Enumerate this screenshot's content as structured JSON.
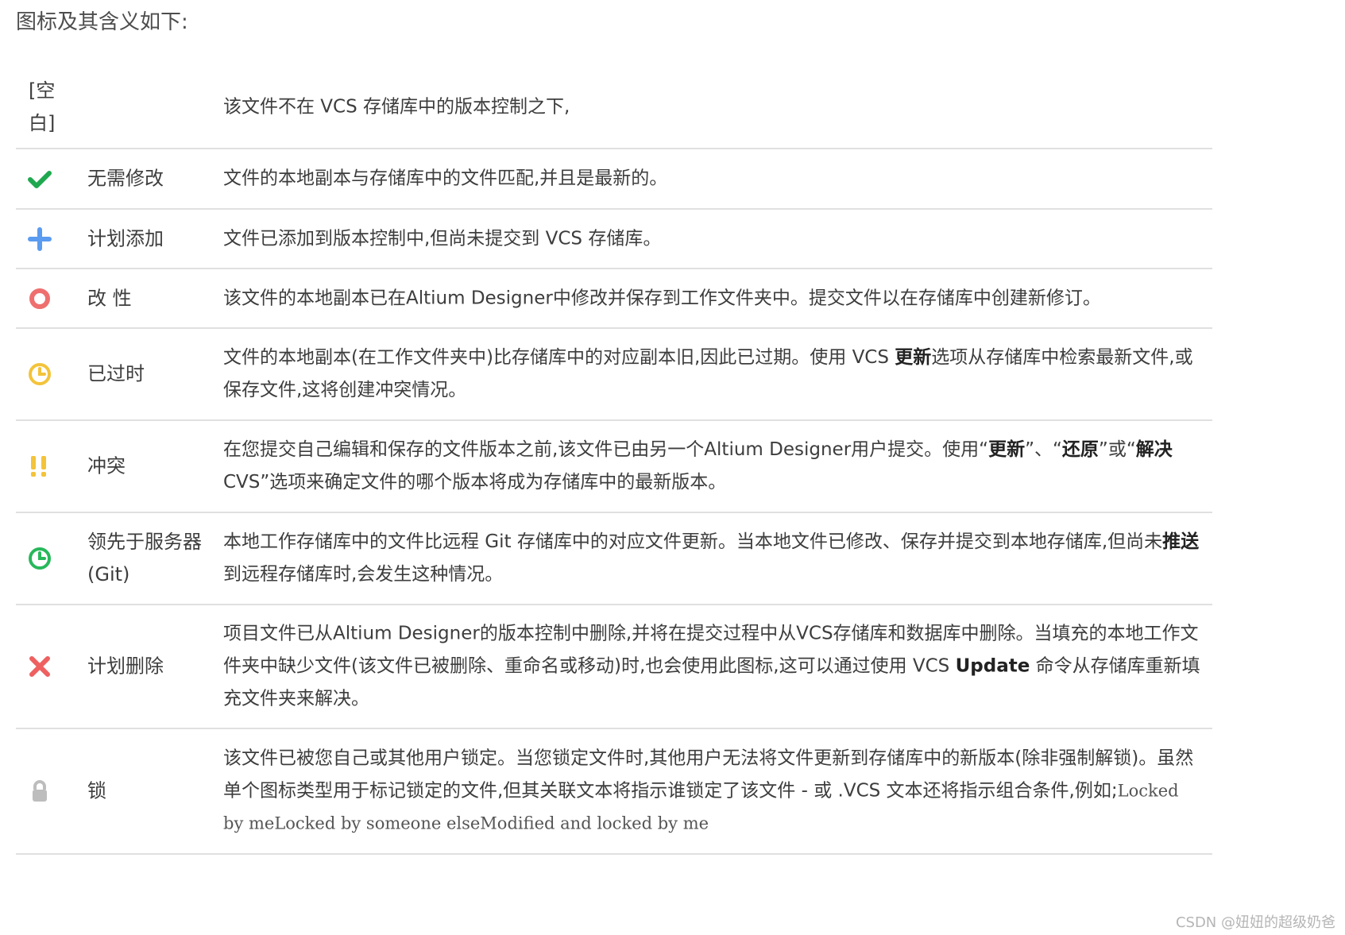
{
  "intro": "图标及其含义如下:",
  "colors": {
    "check": "#1fa84f",
    "plus": "#5b9bf0",
    "circle": "#ef6f6f",
    "clock_yellow": "#f3c33a",
    "exclaim": "#f3c33a",
    "clock_green": "#27b85a",
    "cross": "#ef6060",
    "lock": "#bdbdbd"
  },
  "rows": [
    {
      "icon": "none",
      "name": "[空白]",
      "desc": "该文件不在 VCS 存储库中的版本控制之下,"
    },
    {
      "icon": "check-icon",
      "name": "无需修改",
      "desc": "文件的本地副本与存储库中的文件匹配,并且是最新的。"
    },
    {
      "icon": "plus-icon",
      "name": "计划添加",
      "desc": "文件已添加到版本控制中,但尚未提交到 VCS 存储库。"
    },
    {
      "icon": "circle-icon",
      "name": "改 性",
      "desc": "该文件的本地副本已在Altium Designer中修改并保存到工作文件夹中。提交文件以在存储库中创建新修订。"
    },
    {
      "icon": "clock-icon",
      "name": "已过时",
      "desc_a": "文件的本地副本(在工作文件夹中)比存储库中的对应副本旧,因此已过期。使用 VCS ",
      "desc_b": "更新",
      "desc_c": "选项从存储库中检索最新文件,或保存文件,这将创建冲突情况。"
    },
    {
      "icon": "exclamation-icon",
      "name": "冲突",
      "desc_a": "在您提交自己编辑和保存的文件版本之前,该文件已由另一个Altium Designer用户提交。使用“",
      "desc_b": "更新",
      "desc_c": "”、“",
      "desc_d": "还原",
      "desc_e": "”或“",
      "desc_f": "解决",
      "desc_g": "CVS”选项来确定文件的哪个版本将成为存储库中的最新版本。"
    },
    {
      "icon": "clock-green-icon",
      "name": "领先于服务器(Git)",
      "desc_a": "本地工作存储库中的文件比远程 Git 存储库中的对应文件更新。当本地文件已修改、保存并提交到本地存储库,但尚未",
      "desc_b": "推送",
      "desc_c": "到远程存储库时,会发生这种情况。"
    },
    {
      "icon": "cross-icon",
      "name": "计划删除",
      "desc_a": "项目文件已从Altium Designer的版本控制中删除,并将在提交过程中从VCS存储库和数据库中删除。当填充的本地工作文件夹中缺少文件(该文件已被删除、重命名或移动)时,也会使用此图标,这可以通过使用 VCS ",
      "desc_b": "Update",
      "desc_c": " 命令从存储库重新填充文件夹来解决。"
    },
    {
      "icon": "lock-icon",
      "name": "锁",
      "desc_a": "该文件已被您自己或其他用户锁定。当您锁定文件时,其他用户无法将文件更新到存储库中的新版本(除非强制解锁)。虽然单个图标类型用于标记锁定的文件,但其关联文本将指示谁锁定了该文件 - 或 .VCS 文本还将指示组合条件,例如;",
      "desc_b": "Locked by meLocked by someone elseModified and locked by me"
    }
  ],
  "watermark": "CSDN @妞妞的超级奶爸"
}
